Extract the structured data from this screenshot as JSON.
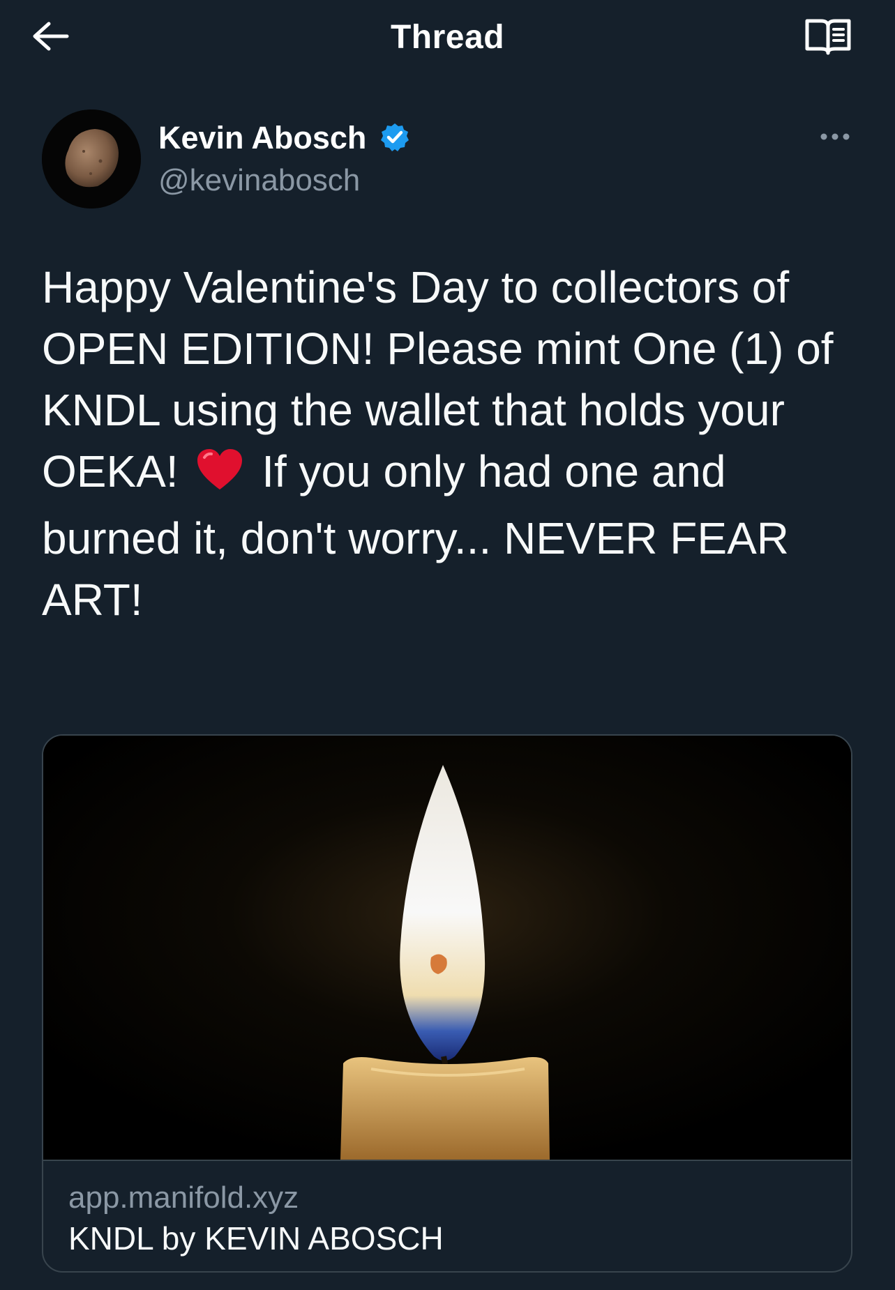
{
  "header": {
    "title": "Thread",
    "back_icon": "arrow-left-icon",
    "reader_icon": "reader-mode-book-icon"
  },
  "tweet": {
    "author_name": "Kevin Abosch",
    "handle": "@kevinabosch",
    "verified": true,
    "more_icon": "more-dots-icon",
    "text_before_emoji": "Happy Valentine's Day to collectors of OPEN EDITION! Please mint One (1) of KNDL using the wallet that holds your OEKA!",
    "emoji": "heart-emoji",
    "text_after_emoji": "If you only had one and burned it, don't worry... NEVER FEAR ART!"
  },
  "card": {
    "domain": "app.manifold.xyz",
    "title": "KNDL by KEVIN ABOSCH"
  },
  "colors": {
    "background": "#15202b",
    "secondary_text": "#8b98a5",
    "border": "#38444d",
    "verified_blue": "#1d9bf0",
    "heart_red": "#e0102e"
  }
}
